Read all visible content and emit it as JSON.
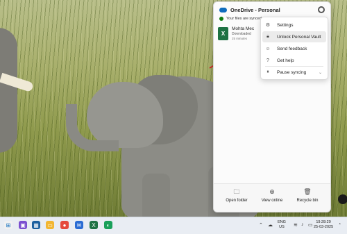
{
  "onedrive": {
    "title": "OneDrive - Personal",
    "sync_status": "Your files are synced",
    "recent_file": {
      "name": "Mohta Mec",
      "status": "Downloaded",
      "time": "25 minutes"
    },
    "menu": [
      {
        "label": "Settings",
        "icon": "gear-icon"
      },
      {
        "label": "Unlock Personal Vault",
        "icon": "lock-icon"
      },
      {
        "label": "Send feedback",
        "icon": "feedback-icon"
      },
      {
        "label": "Get help",
        "icon": "help-icon"
      },
      {
        "label": "Pause syncing",
        "icon": "pause-icon"
      }
    ],
    "footer": [
      {
        "label": "Open folder",
        "icon": "folder-icon"
      },
      {
        "label": "View online",
        "icon": "globe-icon"
      },
      {
        "label": "Recycle bin",
        "icon": "trash-icon"
      }
    ]
  },
  "taskbar": {
    "language": "ENG",
    "region": "US",
    "time": "19:28:29",
    "date": "25-03-2025"
  }
}
